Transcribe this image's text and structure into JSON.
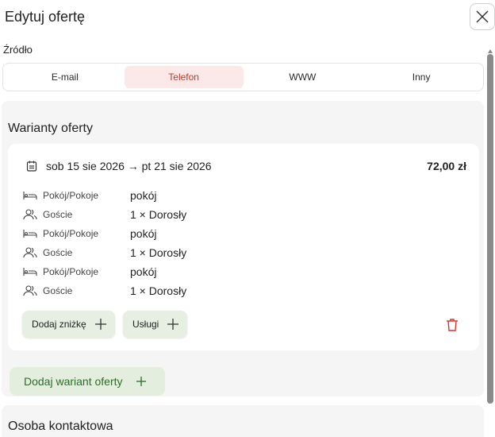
{
  "header": {
    "title": "Edytuj ofertę",
    "close_icon": "close-icon"
  },
  "source": {
    "label": "Źródło",
    "options": [
      "E-mail",
      "Telefon",
      "WWW",
      "Inny"
    ],
    "selected": "Telefon",
    "accent_color": "#c0392b"
  },
  "variants": {
    "title": "Warianty oferty",
    "card": {
      "date_range": "sob 15 sie 2026 → pt 21 sie 2026",
      "price": "72,00 zł",
      "details": [
        {
          "icon": "bed-icon",
          "label": "Pokój/Pokoje",
          "value": "pokój"
        },
        {
          "icon": "guests-icon",
          "label": "Goście",
          "value": "1 × Dorosły"
        },
        {
          "icon": "bed-icon",
          "label": "Pokój/Pokoje",
          "value": "pokój"
        },
        {
          "icon": "guests-icon",
          "label": "Goście",
          "value": "1 × Dorosły"
        },
        {
          "icon": "bed-icon",
          "label": "Pokój/Pokoje",
          "value": "pokój"
        },
        {
          "icon": "guests-icon",
          "label": "Goście",
          "value": "1 × Dorosły"
        }
      ],
      "add_discount_label": "Dodaj zniżkę",
      "services_label": "Usługi"
    },
    "add_variant_label": "Dodaj wariant oferty"
  },
  "contact": {
    "title": "Osoba kontaktowa"
  }
}
